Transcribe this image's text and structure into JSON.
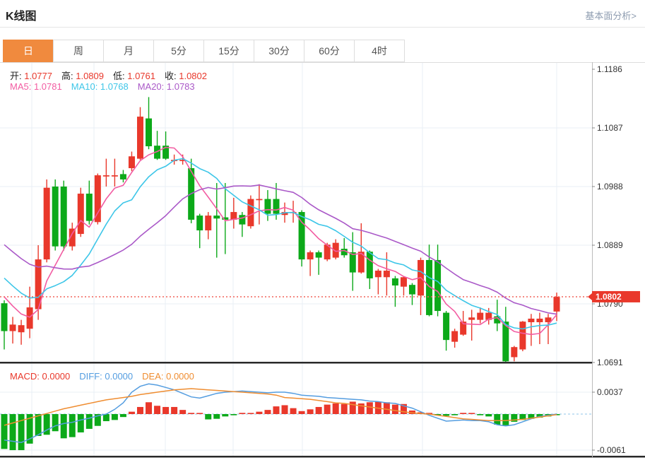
{
  "header": {
    "title": "K线图",
    "link": "基本面分析>"
  },
  "tabs": {
    "items": [
      "日",
      "周",
      "月",
      "5分",
      "15分",
      "30分",
      "60分",
      "4时"
    ],
    "active_index": 0
  },
  "legend": {
    "ohlc": [
      {
        "label": "开:",
        "value": "1.0777"
      },
      {
        "label": "高:",
        "value": "1.0809"
      },
      {
        "label": "低:",
        "value": "1.0761"
      },
      {
        "label": "收:",
        "value": "1.0802"
      }
    ],
    "ma": [
      {
        "label": "MA5:",
        "value": "1.0781",
        "color": "#f25ca2"
      },
      {
        "label": "MA10:",
        "value": "1.0768",
        "color": "#3dc6e8"
      },
      {
        "label": "MA20:",
        "value": "1.0783",
        "color": "#aa59c8"
      }
    ],
    "macd": [
      {
        "label": "MACD:",
        "value": "0.0000",
        "color": "#e9382b"
      },
      {
        "label": "DIFF:",
        "value": "0.0000",
        "color": "#549de0"
      },
      {
        "label": "DEA:",
        "value": "0.0000",
        "color": "#ef8d31"
      }
    ]
  },
  "axes": {
    "price_ticks": [
      "1.1186",
      "1.1087",
      "1.0988",
      "1.0889",
      "1.0790",
      "1.0691"
    ],
    "price_range": [
      1.0691,
      1.1186
    ],
    "macd_ticks": [
      "0.0037",
      "-0.0061"
    ],
    "macd_range": [
      -0.0061,
      0.0037
    ]
  },
  "current_price": {
    "value": "1.0802",
    "price": 1.0802
  },
  "colors": {
    "up": "#e9382b",
    "down": "#0ca919",
    "ma5": "#f25ca2",
    "ma10": "#3dc6e8",
    "ma20": "#aa59c8",
    "diff": "#549de0",
    "dea": "#ef8d31",
    "tab_active": "#f08a3e",
    "price_line": "#f2635a",
    "badge": "#e9382b",
    "grid": "#e9eff5",
    "axis_text": "#333",
    "zero_line": "#b5d8f0"
  },
  "chart_data": {
    "type": "candlestick+macd",
    "title": "K线图 (daily K-line with MA5/MA10/MA20 and MACD)",
    "candles": [
      {
        "o": 1.0791,
        "h": 1.0796,
        "l": 1.0713,
        "c": 1.0744
      },
      {
        "o": 1.0744,
        "h": 1.0768,
        "l": 1.0723,
        "c": 1.0755
      },
      {
        "o": 1.0742,
        "h": 1.0763,
        "l": 1.0721,
        "c": 1.0754
      },
      {
        "o": 1.0748,
        "h": 1.0819,
        "l": 1.0732,
        "c": 1.0784
      },
      {
        "o": 1.0781,
        "h": 1.0889,
        "l": 1.0763,
        "c": 1.0865
      },
      {
        "o": 1.0865,
        "h": 1.1,
        "l": 1.086,
        "c": 1.0986
      },
      {
        "o": 1.0988,
        "h": 1.1,
        "l": 1.088,
        "c": 1.0887
      },
      {
        "o": 1.0988,
        "h": 1.0998,
        "l": 1.088,
        "c": 1.0887
      },
      {
        "o": 1.0887,
        "h": 1.0927,
        "l": 1.088,
        "c": 1.0917
      },
      {
        "o": 1.0908,
        "h": 1.0986,
        "l": 1.0903,
        "c": 1.0976
      },
      {
        "o": 1.0976,
        "h": 1.0998,
        "l": 1.0924,
        "c": 1.093
      },
      {
        "o": 1.0928,
        "h": 1.101,
        "l": 1.0924,
        "c": 1.1007
      },
      {
        "o": 1.1005,
        "h": 1.1035,
        "l": 1.0988,
        "c": 1.1007
      },
      {
        "o": 1.1005,
        "h": 1.1035,
        "l": 1.0988,
        "c": 1.1007
      },
      {
        "o": 1.1009,
        "h": 1.1016,
        "l": 1.0995,
        "c": 1.1
      },
      {
        "o": 1.1019,
        "h": 1.1047,
        "l": 1.1014,
        "c": 1.1039
      },
      {
        "o": 1.1035,
        "h": 1.1122,
        "l": 1.1033,
        "c": 1.1106
      },
      {
        "o": 1.1103,
        "h": 1.1139,
        "l": 1.1051,
        "c": 1.1056
      },
      {
        "o": 1.1057,
        "h": 1.1082,
        "l": 1.1033,
        "c": 1.1035
      },
      {
        "o": 1.1057,
        "h": 1.1081,
        "l": 1.1033,
        "c": 1.1035
      },
      {
        "o": 1.1031,
        "h": 1.1042,
        "l": 1.1025,
        "c": 1.1033
      },
      {
        "o": 1.1031,
        "h": 1.1042,
        "l": 1.1025,
        "c": 1.1033
      },
      {
        "o": 1.1019,
        "h": 1.1035,
        "l": 1.0926,
        "c": 1.0932
      },
      {
        "o": 1.0939,
        "h": 1.0942,
        "l": 1.0884,
        "c": 1.0914
      },
      {
        "o": 1.0914,
        "h": 1.0945,
        "l": 1.0899,
        "c": 1.0939
      },
      {
        "o": 1.0939,
        "h": 1.0994,
        "l": 1.0868,
        "c": 1.0934
      },
      {
        "o": 1.0936,
        "h": 1.0994,
        "l": 1.0874,
        "c": 1.0932
      },
      {
        "o": 1.0932,
        "h": 1.0969,
        "l": 1.0917,
        "c": 1.0945
      },
      {
        "o": 1.094,
        "h": 1.0945,
        "l": 1.0903,
        "c": 1.0924
      },
      {
        "o": 1.0921,
        "h": 1.0973,
        "l": 1.0917,
        "c": 1.0967
      },
      {
        "o": 1.0965,
        "h": 1.0992,
        "l": 1.0924,
        "c": 1.0967
      },
      {
        "o": 1.0967,
        "h": 1.0982,
        "l": 1.093,
        "c": 1.0942
      },
      {
        "o": 1.0967,
        "h": 1.0994,
        "l": 1.0932,
        "c": 1.0942
      },
      {
        "o": 1.094,
        "h": 1.0961,
        "l": 1.0927,
        "c": 1.0945
      },
      {
        "o": 1.0943,
        "h": 1.0964,
        "l": 1.0927,
        "c": 1.0945
      },
      {
        "o": 1.0945,
        "h": 1.0948,
        "l": 1.0853,
        "c": 1.0865
      },
      {
        "o": 1.0865,
        "h": 1.088,
        "l": 1.0837,
        "c": 1.0877
      },
      {
        "o": 1.0877,
        "h": 1.088,
        "l": 1.0839,
        "c": 1.0868
      },
      {
        "o": 1.0865,
        "h": 1.0893,
        "l": 1.0862,
        "c": 1.089
      },
      {
        "o": 1.0868,
        "h": 1.0899,
        "l": 1.0865,
        "c": 1.0893
      },
      {
        "o": 1.0883,
        "h": 1.0901,
        "l": 1.0868,
        "c": 1.0872
      },
      {
        "o": 1.0877,
        "h": 1.0911,
        "l": 1.0812,
        "c": 1.0843
      },
      {
        "o": 1.0843,
        "h": 1.0926,
        "l": 1.0841,
        "c": 1.0878
      },
      {
        "o": 1.0878,
        "h": 1.088,
        "l": 1.0815,
        "c": 1.0833
      },
      {
        "o": 1.0835,
        "h": 1.0849,
        "l": 1.0806,
        "c": 1.0846
      },
      {
        "o": 1.0835,
        "h": 1.0877,
        "l": 1.0804,
        "c": 1.0846
      },
      {
        "o": 1.0833,
        "h": 1.0837,
        "l": 1.0785,
        "c": 1.0821
      },
      {
        "o": 1.0819,
        "h": 1.0837,
        "l": 1.0804,
        "c": 1.0835
      },
      {
        "o": 1.0822,
        "h": 1.0825,
        "l": 1.0788,
        "c": 1.0806
      },
      {
        "o": 1.0804,
        "h": 1.0868,
        "l": 1.0771,
        "c": 1.0864
      },
      {
        "o": 1.0864,
        "h": 1.089,
        "l": 1.0769,
        "c": 1.0771
      },
      {
        "o": 1.0864,
        "h": 1.089,
        "l": 1.0769,
        "c": 1.0778
      },
      {
        "o": 1.0775,
        "h": 1.0778,
        "l": 1.0711,
        "c": 1.0729
      },
      {
        "o": 1.0726,
        "h": 1.0748,
        "l": 1.0716,
        "c": 1.0744
      },
      {
        "o": 1.0738,
        "h": 1.0778,
        "l": 1.0736,
        "c": 1.076
      },
      {
        "o": 1.0763,
        "h": 1.078,
        "l": 1.0728,
        "c": 1.0767
      },
      {
        "o": 1.0763,
        "h": 1.0784,
        "l": 1.0757,
        "c": 1.0775
      },
      {
        "o": 1.0763,
        "h": 1.0783,
        "l": 1.0755,
        "c": 1.0775
      },
      {
        "o": 1.0769,
        "h": 1.0797,
        "l": 1.0744,
        "c": 1.0757
      },
      {
        "o": 1.076,
        "h": 1.0785,
        "l": 1.0691,
        "c": 1.0693
      },
      {
        "o": 1.07,
        "h": 1.0719,
        "l": 1.0693,
        "c": 1.0717
      },
      {
        "o": 1.0713,
        "h": 1.0761,
        "l": 1.071,
        "c": 1.076
      },
      {
        "o": 1.0759,
        "h": 1.0773,
        "l": 1.0719,
        "c": 1.0765
      },
      {
        "o": 1.0759,
        "h": 1.0775,
        "l": 1.0722,
        "c": 1.0765
      },
      {
        "o": 1.0759,
        "h": 1.0773,
        "l": 1.0722,
        "c": 1.0767
      },
      {
        "o": 1.0777,
        "h": 1.0809,
        "l": 1.0761,
        "c": 1.0802
      }
    ],
    "macd": {
      "hist": [
        -0.0059,
        -0.0061,
        -0.0061,
        -0.005,
        -0.0037,
        -0.0035,
        -0.0029,
        -0.0041,
        -0.0039,
        -0.0031,
        -0.0025,
        -0.002,
        -0.0012,
        -0.001,
        -0.0005,
        0.0004,
        0.0012,
        0.002,
        0.0014,
        0.0012,
        0.0012,
        0.0007,
        0.0002,
        0.0,
        -0.0009,
        -0.0008,
        -0.0004,
        -0.0002,
        0.0002,
        0.0001,
        0.0004,
        0.0007,
        0.0013,
        0.0015,
        0.001,
        0.0005,
        0.0008,
        0.0012,
        0.0016,
        0.0018,
        0.0017,
        0.0021,
        0.0018,
        0.002,
        0.0021,
        0.002,
        0.0016,
        0.0017,
        0.0006,
        0.0003,
        0.0002,
        -0.0001,
        -0.0003,
        -0.0002,
        0.0002,
        0.0,
        -0.0002,
        -0.0004,
        -0.0018,
        -0.0019,
        -0.0013,
        -0.001,
        -0.0008,
        -0.0006,
        -0.0004,
        -0.0001
      ],
      "diff": [
        -0.0044,
        -0.0046,
        -0.0048,
        -0.0042,
        -0.0035,
        -0.0027,
        -0.002,
        -0.0016,
        -0.0014,
        -0.001,
        -0.0007,
        -0.0003,
        0.0,
        0.0008,
        0.0019,
        0.0037,
        0.0047,
        0.0051,
        0.0049,
        0.0045,
        0.0041,
        0.0035,
        0.0029,
        0.0027,
        0.0031,
        0.0035,
        0.0037,
        0.0038,
        0.0039,
        0.0038,
        0.0037,
        0.0036,
        0.0037,
        0.0037,
        0.0035,
        0.0032,
        0.0031,
        0.003,
        0.0028,
        0.0027,
        0.0026,
        0.0025,
        0.0024,
        0.0022,
        0.0021,
        0.0019,
        0.0018,
        0.0014,
        0.001,
        0.0004,
        -0.0002,
        -0.0007,
        -0.0012,
        -0.0011,
        -0.001,
        -0.0011,
        -0.0011,
        -0.0013,
        -0.0018,
        -0.002,
        -0.0018,
        -0.0013,
        -0.0008,
        -0.0004,
        -0.0002,
        0.0
      ],
      "dea": [
        -0.0019,
        -0.0015,
        -0.0011,
        -0.0007,
        -0.0003,
        0.0001,
        0.0005,
        0.0009,
        0.0012,
        0.0015,
        0.0018,
        0.0021,
        0.0024,
        0.0026,
        0.0028,
        0.003,
        0.0033,
        0.0035,
        0.0037,
        0.0039,
        0.0041,
        0.0042,
        0.0043,
        0.0042,
        0.0041,
        0.004,
        0.0039,
        0.0038,
        0.0037,
        0.0036,
        0.0035,
        0.0034,
        0.0032,
        0.0028,
        0.0027,
        0.0026,
        0.0025,
        0.0023,
        0.0021,
        0.0019,
        0.0018,
        0.0016,
        0.0014,
        0.0012,
        0.001,
        0.0008,
        0.0006,
        0.0004,
        0.0002,
        0.0001,
        0.0,
        -0.0002,
        -0.0004,
        -0.0006,
        -0.0008,
        -0.0009,
        -0.001,
        -0.0011,
        -0.0011,
        -0.0011,
        -0.001,
        -0.0009,
        -0.0007,
        -0.0005,
        -0.0003,
        -0.0001
      ]
    }
  }
}
